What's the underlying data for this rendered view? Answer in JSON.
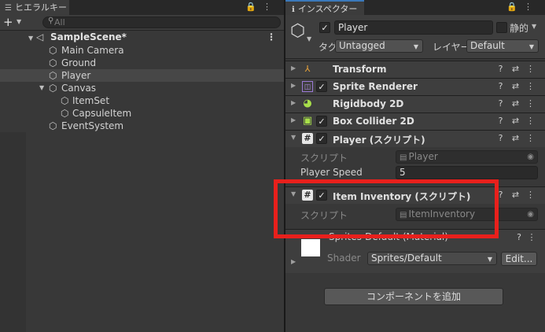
{
  "hierarchy": {
    "tab_label": "ヒエラルキー",
    "tab_tools": [
      "🔒",
      "⋮"
    ],
    "search_placeholder": "All",
    "scene_name": "SampleScene*",
    "items": [
      {
        "label": "Main Camera"
      },
      {
        "label": "Ground"
      },
      {
        "label": "Player",
        "selected": true
      },
      {
        "label": "Canvas"
      },
      {
        "label": "ItemSet"
      },
      {
        "label": "CapsuleItem"
      },
      {
        "label": "EventSystem"
      }
    ]
  },
  "inspector": {
    "tab_label": "インスペクター",
    "tab_tools": [
      "🔒",
      "⋮"
    ],
    "object_name": "Player",
    "static_label": "静的",
    "tag_label": "タグ",
    "tag_value": "Untagged",
    "layer_label": "レイヤー",
    "layer_value": "Default",
    "components": [
      {
        "title": "Transform",
        "icon": "transform-icon",
        "has_checkbox": false
      },
      {
        "title": "Sprite Renderer",
        "icon": "sprite-renderer-icon",
        "has_checkbox": true
      },
      {
        "title": "Rigidbody 2D",
        "icon": "rigidbody-icon",
        "has_checkbox": false
      },
      {
        "title": "Box Collider 2D",
        "icon": "box-collider-icon",
        "has_checkbox": true
      },
      {
        "title": "Player (スクリプト)",
        "icon": "script-icon",
        "has_checkbox": true
      },
      {
        "title": "Item Inventory (スクリプト)",
        "icon": "script-icon",
        "has_checkbox": true
      }
    ],
    "player_script": {
      "script_label": "スクリプト",
      "script_value": "Player",
      "speed_label": "Player Speed",
      "speed_value": "5"
    },
    "item_inventory_script": {
      "script_label": "スクリプト",
      "script_value": "ItemInventory"
    },
    "material": {
      "name": "Sprites-Default (Material)",
      "shader_label": "Shader",
      "shader_value": "Sprites/Default",
      "edit_button": "Edit..."
    },
    "add_component_button": "コンポーネントを追加"
  },
  "colors": {
    "panel_bg": "#383838",
    "header_bg": "#3e3e3e",
    "selection": "#474747",
    "highlight_border": "#e8201c",
    "accent_tab": "#3a79bb"
  }
}
